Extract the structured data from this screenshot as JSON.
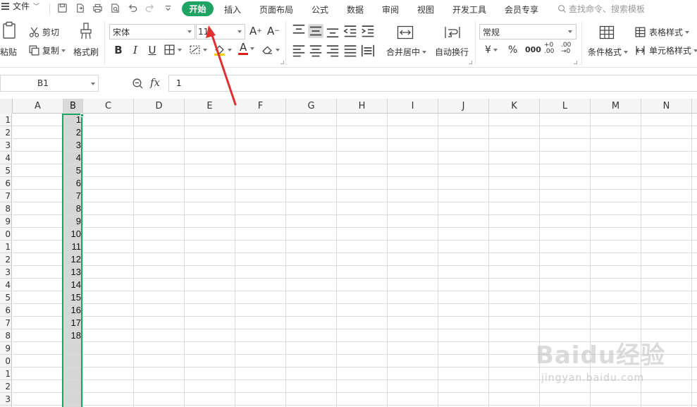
{
  "menubar": {
    "file_label": "文件",
    "tabs": [
      "开始",
      "插入",
      "页面布局",
      "公式",
      "数据",
      "审阅",
      "视图",
      "开发工具",
      "会员专享"
    ],
    "search_placeholder": "查找命令、搜索模板"
  },
  "ribbon": {
    "paste_label": "粘贴",
    "cut_label": "剪切",
    "copy_label": "复制",
    "format_painter_label": "格式刷",
    "font_name": "宋体",
    "font_size": "11",
    "bold": "B",
    "italic": "I",
    "underline": "U",
    "merge_center_label": "合并居中",
    "wrap_text_label": "自动换行",
    "number_format": "常规",
    "currency_symbol": "¥",
    "percent_symbol": "%",
    "thousands_label": "000",
    "dec_inc_label": "+0\n.00",
    "dec_dec_label": ".00\n→0",
    "conditional_format_label": "条件格式",
    "table_style_label": "表格样式",
    "cell_style_label": "单元格样式"
  },
  "formula_bar": {
    "name_box": "B1",
    "fx": "fx",
    "value": "1"
  },
  "grid": {
    "columns": [
      "A",
      "B",
      "C",
      "D",
      "E",
      "F",
      "G",
      "H",
      "I",
      "J",
      "K",
      "L",
      "M",
      "N"
    ],
    "selected_column": "B",
    "row_labels": [
      "1",
      "2",
      "3",
      "4",
      "5",
      "6",
      "7",
      "8",
      "9",
      "0",
      "1",
      "2",
      "3",
      "4",
      "5",
      "6",
      "7",
      "8",
      "9",
      "0",
      "1",
      "2",
      "3"
    ],
    "b_values": [
      "1",
      "2",
      "3",
      "4",
      "5",
      "6",
      "7",
      "8",
      "9",
      "10",
      "11",
      "12",
      "13",
      "14",
      "15",
      "16",
      "17",
      "18"
    ]
  },
  "colors": {
    "accent": "#1fa363",
    "arrow": "#e03030",
    "selection_fill": "#d6d6d6"
  },
  "watermark": {
    "logo": "Baidu经验",
    "sub": "jingyan.baidu.com"
  }
}
